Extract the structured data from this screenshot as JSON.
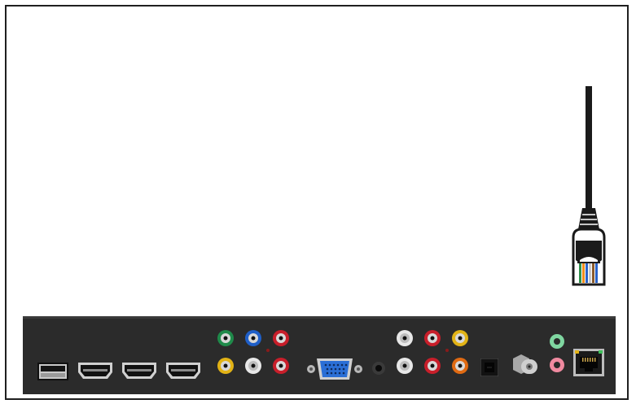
{
  "colors": {
    "frame_border": "#1f1f1f",
    "panel": "#2b2b2b",
    "cable": "#1a1a1a",
    "rca_green": "#1f8a4a",
    "rca_blue": "#1f5fc8",
    "rca_red": "#c81e2a",
    "rca_yellow": "#e2b316",
    "rca_white": "#e8e8e8",
    "rca_orange": "#e06a12",
    "vga_blue": "#2b6fd6",
    "audio_green": "#7fd6a0",
    "audio_pink": "#f08aa0"
  },
  "icons": {
    "cable": "ethernet-cable-icon",
    "connector": "rj45-connector-icon",
    "usb": "usb-port-icon",
    "hdmi": "hdmi-port-icon",
    "rca": "rca-jack-icon",
    "vga": "vga-port-icon",
    "optical": "optical-port-icon",
    "coax": "coax-port-icon",
    "ethernet": "ethernet-port-icon"
  }
}
